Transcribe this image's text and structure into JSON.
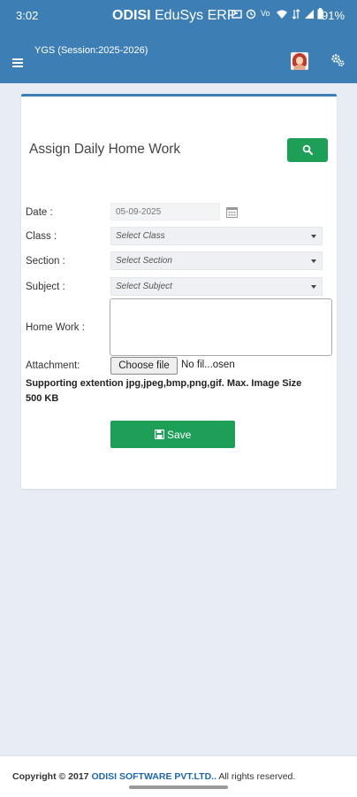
{
  "status_bar": {
    "time": "3:02",
    "title_bold": "ODISI",
    "title_rest": " EduSys ERP",
    "battery": "91%"
  },
  "header": {
    "session": "YGS (Session:2025-2026)"
  },
  "form": {
    "title": "Assign Daily Home Work",
    "date_label": "Date :",
    "date_placeholder": "05-09-2025",
    "class_label": "Class :",
    "class_value": "Select Class",
    "section_label": "Section :",
    "section_value": "Select Section",
    "subject_label": "Subject :",
    "subject_value": "Select Subject",
    "homework_label": "Home Work :",
    "attachment_label": "Attachment:",
    "choose_file": "Choose file",
    "file_status": "No fil...osen",
    "support_note": "Supporting extention jpg,jpeg,bmp,png,gif. Max. Image Size 500 KB",
    "save_label": "Save"
  },
  "footer": {
    "prefix": "Copyright © 2017 ",
    "company": "ODISI SOFTWARE PVT.LTD..",
    "suffix": " All rights reserved."
  },
  "colors": {
    "primary": "#3d7fb5",
    "success": "#1e9f58",
    "background": "#e8edf3"
  }
}
